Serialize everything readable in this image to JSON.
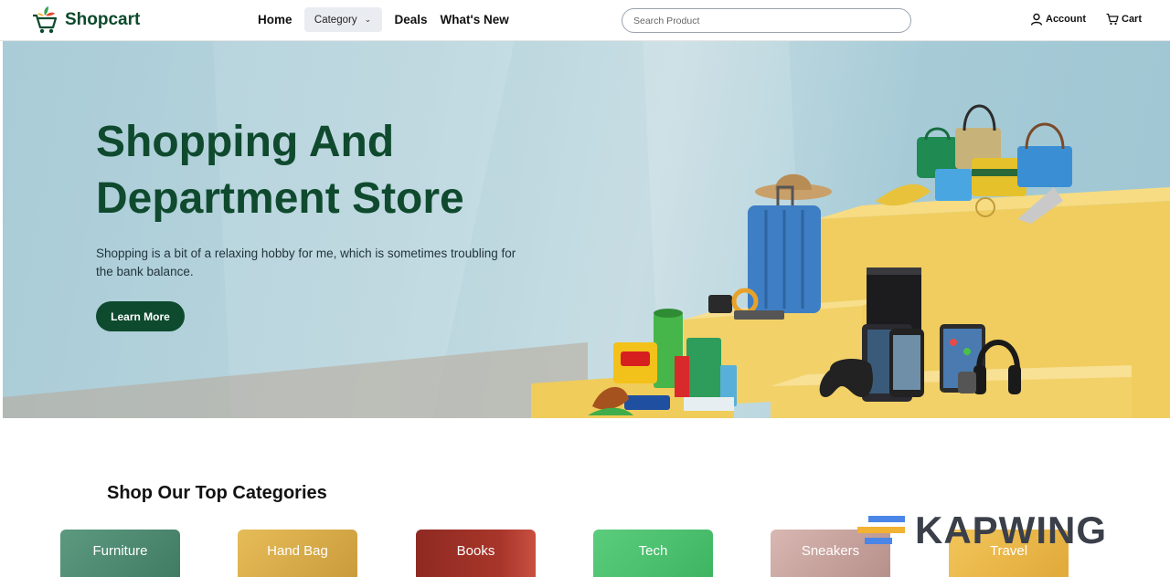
{
  "brand": {
    "name": "Shopcart"
  },
  "nav": {
    "home": "Home",
    "category": "Category",
    "deals": "Deals",
    "whats_new": "What's New"
  },
  "search": {
    "placeholder": "Search Product"
  },
  "header_actions": {
    "account": "Account",
    "cart": "Cart"
  },
  "hero": {
    "title_line1": "Shopping And",
    "title_line2": "Department Store",
    "subtitle": "Shopping is a bit of a relaxing hobby for me, which is sometimes troubling for the bank balance.",
    "button": "Learn More"
  },
  "categories": {
    "heading": "Shop Our Top Categories",
    "items": [
      {
        "label": "Furniture",
        "color": "#4f8a72"
      },
      {
        "label": "Hand Bag",
        "color": "#d7ae4e"
      },
      {
        "label": "Books",
        "color": "#9a2b22"
      },
      {
        "label": "Tech",
        "color": "#4cbf6e"
      },
      {
        "label": "Sneakers",
        "color": "#c9a8a4"
      },
      {
        "label": "Travel",
        "color": "#e9b94a"
      }
    ]
  },
  "watermark": {
    "text": "KAPWING"
  },
  "colors": {
    "brand_green": "#0e4a2e",
    "hero_bg": "#b9d5de",
    "podium_yellow": "#f2d168"
  }
}
